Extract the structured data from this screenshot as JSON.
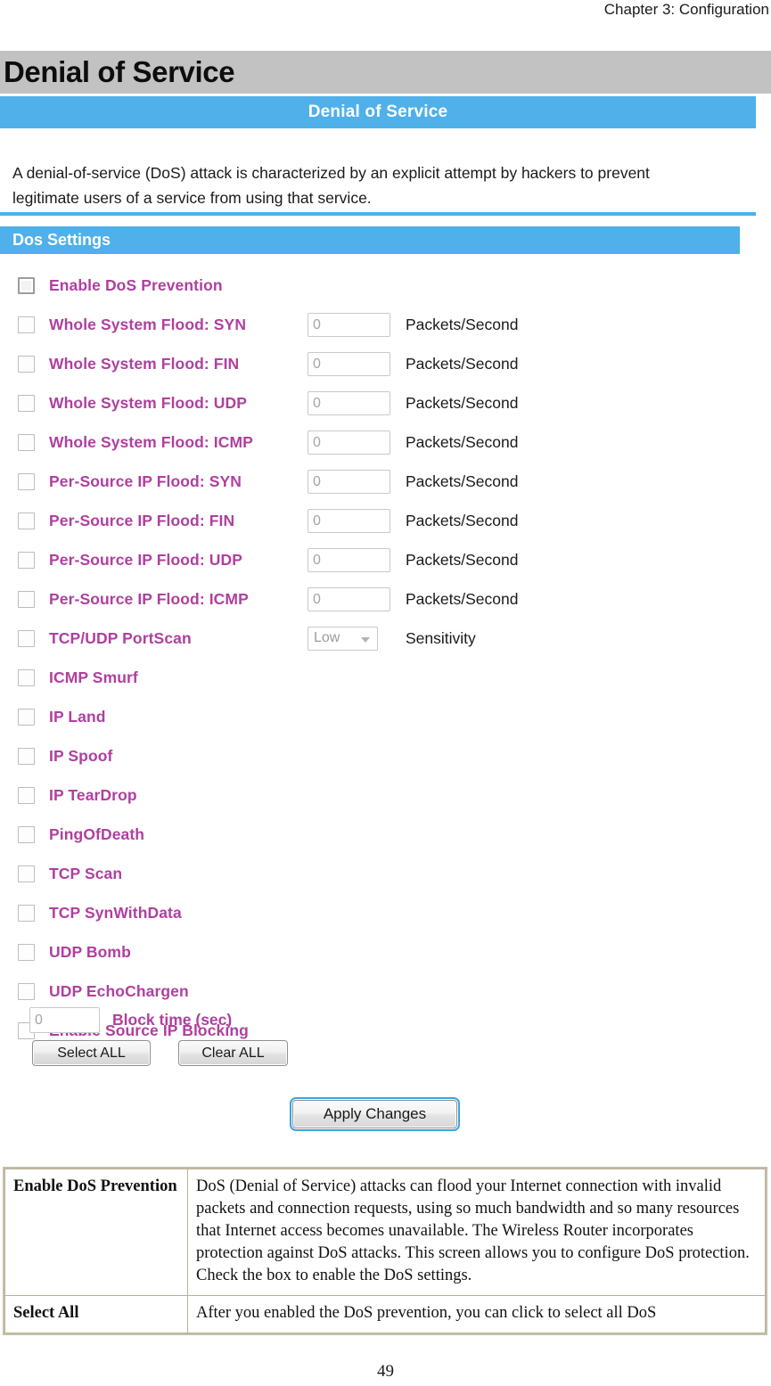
{
  "document": {
    "running_header": "Chapter 3: Configuration",
    "page_heading": "Denial of Service",
    "page_number": "49"
  },
  "device_ui": {
    "title_banner": "Denial of Service",
    "intro_text": "A denial-of-service (DoS) attack is characterized by an explicit attempt by hackers to prevent legitimate users of a service from using that service.",
    "section_bar_label": "Dos Settings",
    "settings": [
      {
        "label": "Enable DoS Prevention",
        "checked": false,
        "emphasis": true,
        "control": "none",
        "value": "",
        "unit": ""
      },
      {
        "label": "Whole System Flood: SYN",
        "checked": false,
        "emphasis": false,
        "control": "text",
        "value": "0",
        "unit": "Packets/Second"
      },
      {
        "label": "Whole System Flood: FIN",
        "checked": false,
        "emphasis": false,
        "control": "text",
        "value": "0",
        "unit": "Packets/Second"
      },
      {
        "label": "Whole System Flood: UDP",
        "checked": false,
        "emphasis": false,
        "control": "text",
        "value": "0",
        "unit": "Packets/Second"
      },
      {
        "label": "Whole System Flood: ICMP",
        "checked": false,
        "emphasis": false,
        "control": "text",
        "value": "0",
        "unit": "Packets/Second"
      },
      {
        "label": "Per-Source IP Flood: SYN",
        "checked": false,
        "emphasis": false,
        "control": "text",
        "value": "0",
        "unit": "Packets/Second"
      },
      {
        "label": "Per-Source IP Flood: FIN",
        "checked": false,
        "emphasis": false,
        "control": "text",
        "value": "0",
        "unit": "Packets/Second"
      },
      {
        "label": "Per-Source IP Flood: UDP",
        "checked": false,
        "emphasis": false,
        "control": "text",
        "value": "0",
        "unit": "Packets/Second"
      },
      {
        "label": "Per-Source IP Flood: ICMP",
        "checked": false,
        "emphasis": false,
        "control": "text",
        "value": "0",
        "unit": "Packets/Second"
      },
      {
        "label": "TCP/UDP PortScan",
        "checked": false,
        "emphasis": false,
        "control": "select",
        "value": "Low",
        "unit": "Sensitivity"
      },
      {
        "label": "ICMP Smurf",
        "checked": false,
        "emphasis": false,
        "control": "none",
        "value": "",
        "unit": ""
      },
      {
        "label": "IP Land",
        "checked": false,
        "emphasis": false,
        "control": "none",
        "value": "",
        "unit": ""
      },
      {
        "label": "IP Spoof",
        "checked": false,
        "emphasis": false,
        "control": "none",
        "value": "",
        "unit": ""
      },
      {
        "label": "IP TearDrop",
        "checked": false,
        "emphasis": false,
        "control": "none",
        "value": "",
        "unit": ""
      },
      {
        "label": "PingOfDeath",
        "checked": false,
        "emphasis": false,
        "control": "none",
        "value": "",
        "unit": ""
      },
      {
        "label": "TCP Scan",
        "checked": false,
        "emphasis": false,
        "control": "none",
        "value": "",
        "unit": ""
      },
      {
        "label": "TCP SynWithData",
        "checked": false,
        "emphasis": false,
        "control": "none",
        "value": "",
        "unit": ""
      },
      {
        "label": "UDP Bomb",
        "checked": false,
        "emphasis": false,
        "control": "none",
        "value": "",
        "unit": ""
      },
      {
        "label": "UDP EchoChargen",
        "checked": false,
        "emphasis": false,
        "control": "none",
        "value": "",
        "unit": ""
      },
      {
        "label": "Enable Source IP Blocking",
        "checked": false,
        "emphasis": false,
        "control": "none",
        "value": "",
        "unit": ""
      }
    ],
    "block_time": {
      "value": "0",
      "label": "Block time (sec)"
    },
    "buttons": {
      "select_all": "Select ALL",
      "clear_all": "Clear ALL",
      "apply_changes": "Apply Changes"
    },
    "colors": {
      "banner_blue": "#4fb0ea",
      "heading_gray": "#c2c2c2",
      "label_magenta": "#b03fa0",
      "focus_ring": "#38a6e0"
    }
  },
  "description_table": {
    "rows": [
      {
        "term": "Enable DoS Prevention",
        "description": "DoS (Denial of Service) attacks can flood your Internet connection with invalid packets and connection requests, using so much bandwidth and so many resources that Internet access becomes unavailable. The Wireless Router incorporates protection against DoS attacks. This screen allows you to configure DoS protection.",
        "description_line2": "Check the box to enable the DoS settings."
      },
      {
        "term": "Select All",
        "description": "After you enabled the DoS prevention, you can click to select all DoS",
        "description_line2": ""
      }
    ]
  }
}
